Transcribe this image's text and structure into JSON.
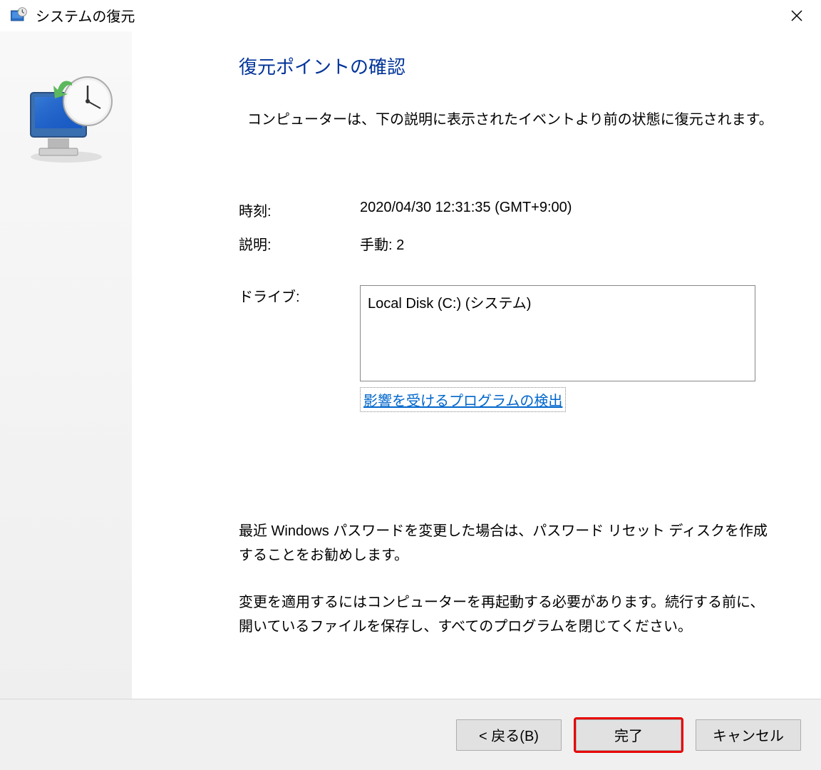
{
  "titlebar": {
    "title": "システムの復元"
  },
  "main": {
    "heading": "復元ポイントの確認",
    "subtext": "コンピューターは、下の説明に表示されたイベントより前の状態に復元されます。",
    "fields": {
      "time_label": "時刻:",
      "time_value": "2020/04/30 12:31:35 (GMT+9:00)",
      "desc_label": "説明:",
      "desc_value": "手動: 2",
      "drive_label": "ドライブ:",
      "drive_value": "Local Disk (C:) (システム)"
    },
    "scan_link": "影響を受けるプログラムの検出",
    "info1": "最近 Windows パスワードを変更した場合は、パスワード リセット ディスクを作成することをお勧めします。",
    "info2": "変更を適用するにはコンピューターを再起動する必要があります。続行する前に、開いているファイルを保存し、すべてのプログラムを閉じてください。"
  },
  "buttons": {
    "back": "< 戻る(B)",
    "finish": "完了",
    "cancel": "キャンセル"
  }
}
